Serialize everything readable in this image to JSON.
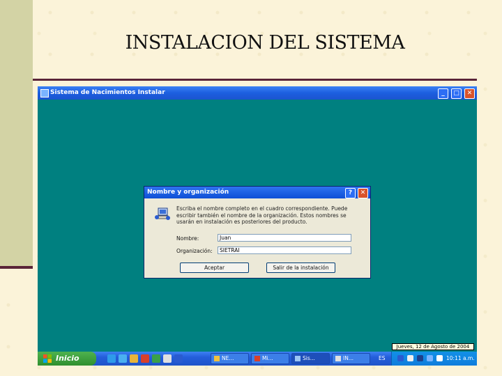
{
  "slide": {
    "title": "INSTALACION DEL SISTEMA"
  },
  "window": {
    "title": "Sistema de Nacimientos Instalar"
  },
  "dialog": {
    "title": "Nombre y organización",
    "message": "Escriba el nombre completo en el cuadro correspondiente. Puede escribir también el nombre de la organización. Estos nombres se usarán en instalación es posteriores del producto.",
    "name_label": "Nombre:",
    "name_value": "Juan",
    "org_label": "Organización:",
    "org_value": "SIETRAI",
    "accept_label": "Aceptar",
    "exit_label": "Salir de la instalación"
  },
  "tooltip": {
    "text": "Jueves, 12 de Agosto de 2004"
  },
  "taskbar": {
    "start_label": "Inicio",
    "tasks": [
      {
        "label": "NE..."
      },
      {
        "label": "Mi..."
      },
      {
        "label": "Sis..."
      },
      {
        "label": "IN..."
      }
    ],
    "language": "ES",
    "clock": "10:11 a.m."
  },
  "colors": {
    "desktop": "#008080",
    "titlebar": "#1c5fe0",
    "accent_rule": "#5a2438",
    "side_band": "#d3d3a5"
  }
}
